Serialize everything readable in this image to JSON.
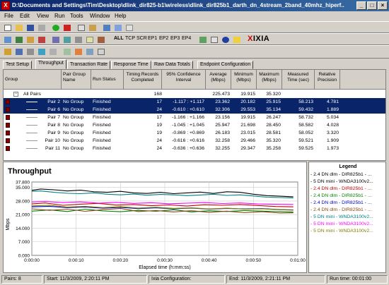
{
  "window": {
    "title": "D:\\Documents and Settings\\Tim\\Desktop\\dlink_dir825-b1\\wireless\\dlink_dir825b1_darth_dn_4stream_2band_40mhz_hiperf...",
    "app_icon_glyph": "X"
  },
  "menu": [
    "File",
    "Edit",
    "View",
    "Run",
    "Tools",
    "Window",
    "Help"
  ],
  "toolbar2_filters": [
    "ALL",
    "TCP",
    "SCR",
    "EP1",
    "EP2",
    "EP3",
    "EP4"
  ],
  "brand": {
    "name": "IXIA",
    "x_glyph": "X"
  },
  "tabs": [
    "Test Setup",
    "Throughput",
    "Transaction Rate",
    "Response Time",
    "Raw Data Totals",
    "Endpoint Configuration"
  ],
  "columns": [
    "Group",
    "Pair Group Name",
    "Run Status",
    "Timing Records Completed",
    "95% Confidence Interval",
    "Average (Mbps)",
    "Minimum (Mbps)",
    "Maximum (Mbps)",
    "Measured Time (sec)",
    "Relative Precision"
  ],
  "all_pairs": {
    "label": "All Pairs",
    "records": "168",
    "avg": "225.473",
    "min": "19.915",
    "max": "35.320"
  },
  "pairs": [
    {
      "name": "Pair 2",
      "group": "No Group",
      "status": "Finished",
      "records": "17",
      "ci": "-1.117 : +1.117",
      "avg": "23.362",
      "min": "20.182",
      "max": "25.915",
      "time": "58.213",
      "precision": "4.781",
      "color": "#000000",
      "selected": true
    },
    {
      "name": "Pair 6",
      "group": "No Group",
      "status": "Finished",
      "records": "24",
      "ci": "-0.610 : +0.610",
      "avg": "32.306",
      "min": "29.553",
      "max": "35.134",
      "time": "59.432",
      "precision": "1.889",
      "color": "#808080",
      "selected": true
    },
    {
      "name": "Pair 7",
      "group": "No Group",
      "status": "Finished",
      "records": "17",
      "ci": "-1.166 : +1.166",
      "avg": "23.156",
      "min": "19.915",
      "max": "26.247",
      "time": "58.732",
      "precision": "5.034",
      "color": "#e0e0e0",
      "selected": false
    },
    {
      "name": "Pair 8",
      "group": "No Group",
      "status": "Finished",
      "records": "19",
      "ci": "-1.045 : +1.045",
      "avg": "25.947",
      "min": "21.698",
      "max": "28.450",
      "time": "58.582",
      "precision": "4.028",
      "color": "#c0c0c0",
      "selected": false
    },
    {
      "name": "Pair 9",
      "group": "No Group",
      "status": "Finished",
      "records": "19",
      "ci": "-0.869 : +0.869",
      "avg": "26.183",
      "min": "23.015",
      "max": "28.581",
      "time": "58.052",
      "precision": "3.320",
      "color": "#a0a0a0",
      "selected": false
    },
    {
      "name": "Pair 10",
      "group": "No Group",
      "status": "Finished",
      "records": "24",
      "ci": "-0.616 : +0.616",
      "avg": "32.258",
      "min": "29.466",
      "max": "35.320",
      "time": "59.521",
      "precision": "1.909",
      "color": "#b0b0b0",
      "selected": false
    },
    {
      "name": "Pair 11",
      "group": "No Group",
      "status": "Finished",
      "records": "24",
      "ci": "-0.636 : +0.636",
      "avg": "32.255",
      "min": "29.347",
      "max": "35.258",
      "time": "59.525",
      "precision": "1.973",
      "color": "#909090",
      "selected": false
    }
  ],
  "legend": {
    "title": "Legend",
    "items": [
      {
        "label": "- 2.4 DN dlm - DIR825b1 - ...",
        "color": "#000000"
      },
      {
        "label": "- 5 DN mini - WNDA3100v2...",
        "color": "#000000"
      },
      {
        "label": "- 2.4 DN dlm - DIR825b1 - ...",
        "color": "#c00000"
      },
      {
        "label": "- 2.4 DN dlm - DIR825b1 - ...",
        "color": "#008000"
      },
      {
        "label": "- 2.4 DN dlm - DIR825b1 - ...",
        "color": "#0000c0"
      },
      {
        "label": "- 2.4 DN dlm - DIR825b1 - ...",
        "color": "#8b4513"
      },
      {
        "label": "- 5 DN mini - WNDA3100v2...",
        "color": "#008080"
      },
      {
        "label": "- 5 DN mini - WNDA3100v2...",
        "color": "#ff00ff"
      },
      {
        "label": "- 5 DN mini - WNDA3100v2...",
        "color": "#808000"
      }
    ]
  },
  "chart_data": {
    "type": "line",
    "title": "Throughput",
    "xlabel": "Elapsed time (h:mm:ss)",
    "ylabel": "Mbps",
    "x_ticks": [
      "0:00:00",
      "0:00:10",
      "0:00:20",
      "0:00:30",
      "0:00:40",
      "0:00:50",
      "0:01:00"
    ],
    "y_ticks": [
      "0.000",
      "7.000",
      "14.000",
      "21.000",
      "28.000",
      "35.000",
      "37.800"
    ],
    "ylim": [
      0,
      37.8
    ],
    "xlim": [
      0,
      60
    ],
    "grid": true,
    "series": [
      {
        "color": "#000000",
        "x": [
          0,
          2,
          5,
          8,
          11,
          14,
          17,
          20,
          23,
          26,
          29,
          32,
          35,
          38,
          41,
          44,
          47,
          50,
          53,
          56,
          59
        ],
        "values": [
          33.5,
          34.2,
          33.8,
          33.2,
          33.6,
          32.8,
          32.5,
          33.0,
          32.2,
          31.9,
          32.5,
          31.8,
          32.2,
          32.6,
          31.9,
          32.8,
          32.5,
          31.5,
          30.8,
          30.5,
          30.2
        ]
      },
      {
        "color": "#008080",
        "x": [
          0,
          2,
          5,
          8,
          11,
          14,
          17,
          20,
          23,
          26,
          29,
          32,
          35,
          38,
          41,
          44,
          47,
          50,
          53,
          56,
          59
        ],
        "values": [
          33.0,
          33.2,
          32.5,
          32.0,
          31.8,
          32.2,
          31.5,
          31.2,
          31.6,
          31.0,
          31.4,
          31.2,
          30.8,
          31.1,
          31.5,
          30.9,
          31.2,
          30.6,
          30.0,
          29.8,
          29.6
        ]
      },
      {
        "color": "#c00000",
        "x": [
          0,
          3,
          7,
          11,
          15,
          19,
          23,
          27,
          31,
          35,
          39,
          43,
          47,
          51,
          55,
          59
        ],
        "values": [
          26.5,
          27.0,
          25.8,
          26.4,
          26.8,
          25.9,
          26.2,
          25.6,
          26.0,
          25.4,
          26.1,
          25.8,
          26.2,
          25.7,
          25.2,
          25.0
        ]
      },
      {
        "color": "#ff00ff",
        "x": [
          0,
          3,
          7,
          11,
          15,
          19,
          23,
          27,
          31,
          35,
          39,
          43,
          47,
          51,
          55,
          59
        ],
        "values": [
          27.5,
          27.8,
          27.2,
          27.6,
          26.9,
          27.3,
          26.8,
          27.1,
          26.6,
          26.9,
          27.2,
          26.7,
          27.0,
          26.5,
          26.3,
          26.2
        ]
      },
      {
        "color": "#0000c0",
        "x": [
          0,
          4,
          8,
          12,
          16,
          20,
          24,
          28,
          32,
          36,
          40,
          44,
          48,
          52,
          56,
          59
        ],
        "values": [
          25.0,
          25.3,
          24.6,
          24.9,
          24.3,
          24.7,
          24.1,
          24.5,
          24.0,
          24.4,
          23.8,
          24.2,
          23.9,
          24.1,
          23.6,
          23.4
        ]
      },
      {
        "color": "#008000",
        "x": [
          0,
          4,
          8,
          12,
          16,
          20,
          24,
          28,
          32,
          36,
          40,
          44,
          48,
          52,
          56,
          59
        ],
        "values": [
          22.8,
          23.4,
          22.6,
          23.8,
          22.9,
          22.5,
          23.2,
          22.7,
          23.5,
          22.4,
          23.0,
          22.6,
          23.1,
          22.8,
          22.5,
          22.3
        ]
      },
      {
        "color": "#8b4513",
        "x": [
          0,
          4,
          8,
          12,
          16,
          20,
          24,
          28,
          32,
          36,
          40,
          44,
          48,
          52,
          56,
          59
        ],
        "values": [
          24.0,
          23.2,
          23.8,
          22.7,
          23.5,
          24.2,
          22.6,
          23.1,
          22.4,
          23.0,
          22.2,
          22.8,
          22.0,
          22.5,
          21.8,
          21.9
        ]
      },
      {
        "color": "#808000",
        "x": [
          0,
          4,
          8,
          12,
          16,
          20,
          24,
          28,
          32,
          36,
          40,
          44,
          48,
          52,
          56,
          59
        ],
        "values": [
          25.5,
          25.8,
          24.9,
          25.3,
          24.6,
          25.1,
          24.4,
          24.8,
          24.2,
          24.5,
          23.9,
          24.3,
          23.8,
          24.0,
          23.5,
          23.3
        ]
      }
    ]
  },
  "status": {
    "pairs": "Pairs: 8",
    "start": "Start: 11/3/2009, 2:20:11 PM",
    "ixia_config": "Ixia Configuration:",
    "end": "End: 11/3/2009, 2:21:11 PM",
    "run_time": "Run time: 00:01:00"
  }
}
